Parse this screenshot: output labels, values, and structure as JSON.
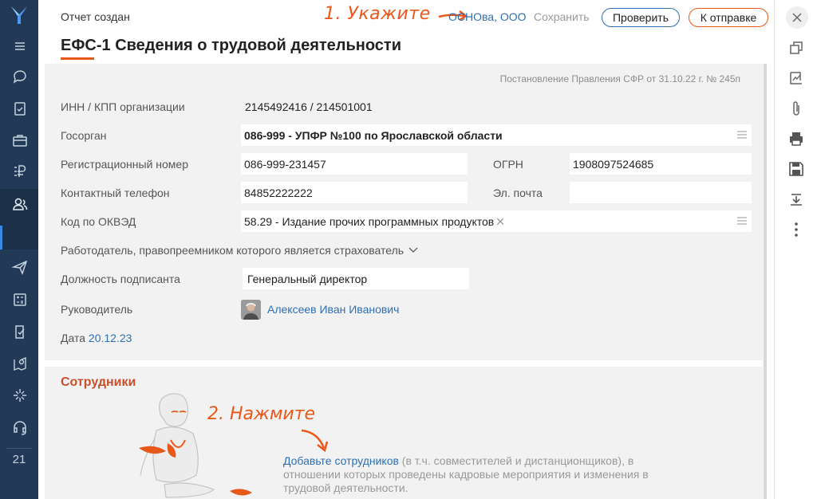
{
  "nav": {
    "badge_number": "21",
    "icons": [
      "logo-icon",
      "menu-icon",
      "chat-icon",
      "tasks-icon",
      "briefcase-icon",
      "ruble-icon",
      "people-icon",
      "send-icon",
      "calculator-icon",
      "check-doc-icon",
      "location-icon",
      "sparkle-icon",
      "headset-icon"
    ]
  },
  "header": {
    "status": "Отчет создан",
    "hint1": "1. Укажите",
    "org_link": "ОСНОва, ООО",
    "save": "Сохранить",
    "check_button": "Проверить",
    "send_button": "К отправке",
    "title": "ЕФС-1 Сведения о трудовой деятельности"
  },
  "form": {
    "decree": "Постановление Правления СФР от 31.10.22 г. № 245п",
    "inn_label": "ИНН / КПП организации",
    "inn_value": "2145492416 / 214501001",
    "gosorgan_label": "Госорган",
    "gosorgan_value": "086-999 - УПФР №100 по Ярославской области",
    "regnum_label": "Регистрационный номер",
    "regnum_value": "086-999-231457",
    "ogrn_label": "ОГРН",
    "ogrn_value": "1908097524685",
    "phone_label": "Контактный телефон",
    "phone_value": "84852222222",
    "email_label": "Эл. почта",
    "email_value": "",
    "okved_label": "Код по ОКВЭД",
    "okved_value": "58.29 - Издание прочих программных продуктов",
    "successor_label": "Работодатель, правопреемником которого является страхователь",
    "position_label": "Должность подписанта",
    "position_value": "Генеральный директор",
    "head_label": "Руководитель",
    "head_value": "Алексеев Иван Иванович",
    "date_label": "Дата",
    "date_value": "20.12.23"
  },
  "employees": {
    "title": "Сотрудники",
    "hint2": "2. Нажмите",
    "add_link": "Добавьте сотрудников",
    "add_rest": " (в т.ч. совместителей и дистанционщиков), в отношении которых проведены кадровые мероприятия и изменения в трудовой деятельности."
  },
  "colors": {
    "nav_bg": "#223A57",
    "accent_orange": "#E8581B",
    "link_blue": "#2E6FB4",
    "panel_bg": "#F2F2F2"
  }
}
